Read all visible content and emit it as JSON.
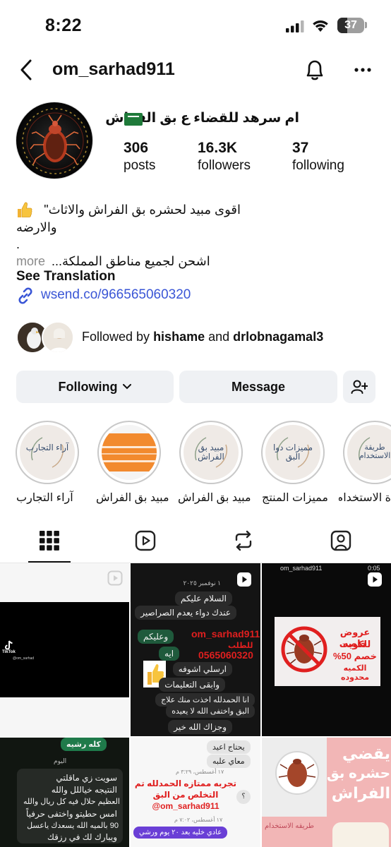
{
  "status_bar": {
    "time": "8:22",
    "battery": "37",
    "battery_level_percent": 37
  },
  "header": {
    "username": "om_sarhad911"
  },
  "profile": {
    "display_name": "ام سرهد للقضاء ع بق الفراش",
    "stats": [
      {
        "value": "306",
        "label": "posts"
      },
      {
        "value": "16.3K",
        "label": "followers"
      },
      {
        "value": "37",
        "label": "following"
      }
    ],
    "bio_lines": [
      "اقوى مبيد لحشره بق الفراش والاثاث\"",
      "والارضه",
      ".",
      "اشحن لجميع مناطق المملكة..."
    ],
    "more_label": "more",
    "see_translation": "See Translation",
    "link": "wsend.co/966565060320"
  },
  "followed_by": {
    "prefix": "Followed by",
    "user1": "hishame",
    "conjunction": "and",
    "user2": "drlobnagamal3"
  },
  "buttons": {
    "following": "Following",
    "message": "Message"
  },
  "highlights": [
    {
      "label": "آراء التجارب",
      "cover_text": "آراء التجارب"
    },
    {
      "label": "مبيد بق الفراش",
      "cover_text": ""
    },
    {
      "label": "مبيد بق الفراش",
      "cover_text": "مبيد بق الفراش"
    },
    {
      "label": "مميزات المنتج",
      "cover_text": "مميزات دوا البق"
    },
    {
      "label": "ة الاستخدام",
      "cover_text": "طريقة الاستخدام"
    }
  ],
  "tabs": [
    "grid-icon",
    "reels-icon",
    "reposts-icon",
    "tagged-icon"
  ],
  "grid": {
    "cell1": {
      "brand": "TikTok",
      "handle": "@om_sarhad"
    },
    "cell2": {
      "date": "١ نوفمبر ٢٠٢٥",
      "msg1": "السلام عليكم",
      "msg2": "عندك دواء يعدم الصراصير",
      "reply1": "وعليكم",
      "reply2": "ايه",
      "promo_user": "om_sarhad911",
      "promo_label": "للطلب",
      "promo_phone": "0565060320",
      "msg3": "ارسلي اشوفه",
      "msg4": "وابقى التعليمات",
      "msg5": "انا الحمدلله اخذت منك علاج",
      "msg6": "البق واختفى الله لا يعيده",
      "msg7": "وجزاك الله خير"
    },
    "cell3": {
      "user": "om_sarhad911",
      "duration": "0:05",
      "line1": "عروض خاصه",
      "line2": "للكويت",
      "line3": "خصم 50%",
      "line4": "الكميه محدوده"
    },
    "cell4": {
      "top": "كله رشيه",
      "today": "اليوم",
      "l1": "سويت زي ماقلتي",
      "l2": "النتيجه خياللل والله",
      "l3": "العظيم حلال فيه كل ريال والله",
      "l4": "امس حطيتو واختفى حرفياً",
      "l5": "90 بالميه الله يسعدك ياعسل",
      "l6": "ويبارك لك في رزقك"
    },
    "cell5": {
      "m1": "يحتاج اعيد",
      "m2": "معاي علبه",
      "date1": "١٧ أغسطس، ٣:٢٩ م",
      "promo1": "تجربه ممتازه الحمدلله تم",
      "promo2": "التخلص من البق",
      "promo_user": "@om_sarhad911",
      "date2": "١٧ أغسطس، ٧:٠٢ م",
      "bottom": "عادي خليه بعد ٢٠ يوم ورشي"
    },
    "cell6": {
      "big1": "يقضي",
      "big2": "حشره بق",
      "big3": "الفراش",
      "small": "طريقه الاستخدام"
    }
  },
  "colors": {
    "link": "#3a56d6",
    "button_bg": "#eff1f4",
    "whatsapp_green": "#1f7a4a",
    "promo_red": "#e01f1f",
    "promo_purple": "#6a3fd6",
    "pink_bg": "#f2b6b6"
  }
}
